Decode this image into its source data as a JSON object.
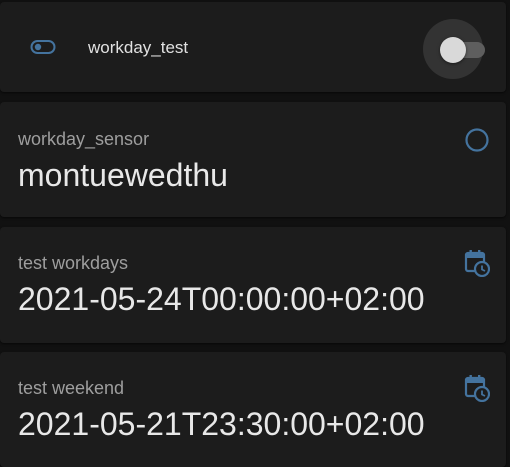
{
  "switch_row": {
    "label": "workday_test",
    "icon": "toggle-switch-outline-icon",
    "state": "off"
  },
  "cards": [
    {
      "name": "workday_sensor",
      "state": "montuewedthu",
      "icon": "circle-outline-icon"
    },
    {
      "name": "test workdays",
      "state": "2021-05-24T00:00:00+02:00",
      "icon": "calendar-clock-icon"
    },
    {
      "name": "test weekend",
      "state": "2021-05-21T23:30:00+02:00",
      "icon": "calendar-clock-icon"
    }
  ],
  "colors": {
    "background": "#111111",
    "card": "#1c1c1c",
    "icon_accent": "#44739e",
    "primary_text": "#e1e1e1",
    "secondary_text": "#9e9e9e"
  }
}
